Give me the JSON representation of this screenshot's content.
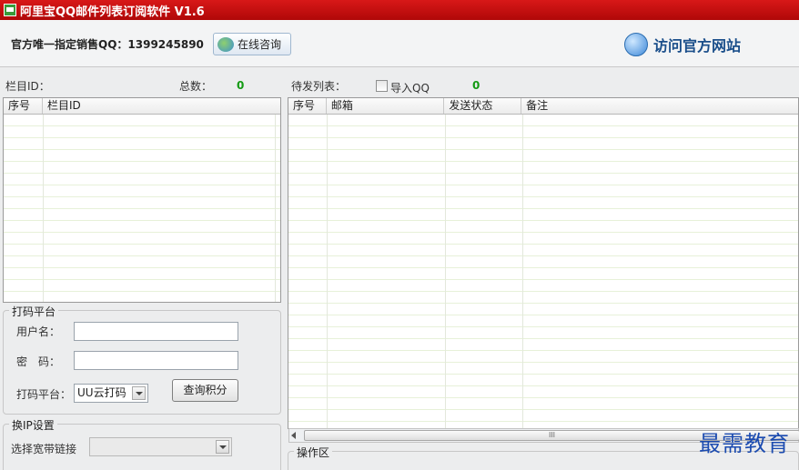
{
  "window": {
    "title": "阿里宝QQ邮件列表订阅软件 V1.6"
  },
  "topbar": {
    "sales_text": "官方唯一指定销售QQ：1399245890",
    "consult_label": "在线咨询",
    "visit_site_label": "访问官方网站"
  },
  "left": {
    "column_id_label": "栏目ID：",
    "total_label": "总数：",
    "total_value": "0",
    "grid_columns": [
      "序号",
      "栏目ID"
    ]
  },
  "right": {
    "pending_label": "待发列表：",
    "import_qq_label": "导入QQ",
    "pending_count": "0",
    "grid_columns": [
      "序号",
      "邮箱",
      "发送状态",
      "备注"
    ],
    "scroll_grip": "III"
  },
  "captcha": {
    "group_title": "打码平台",
    "username_label": "用户名：",
    "password_label": "密　码：",
    "platform_label": "打码平台：",
    "platform_selected": "UU云打码",
    "query_button": "查询积分",
    "username_value": "",
    "password_value": ""
  },
  "ip": {
    "group_title": "换IP设置",
    "broadband_label": "选择宽带链接",
    "broadband_selected": ""
  },
  "ops": {
    "group_title": "操作区"
  },
  "watermark": "最需教育"
}
